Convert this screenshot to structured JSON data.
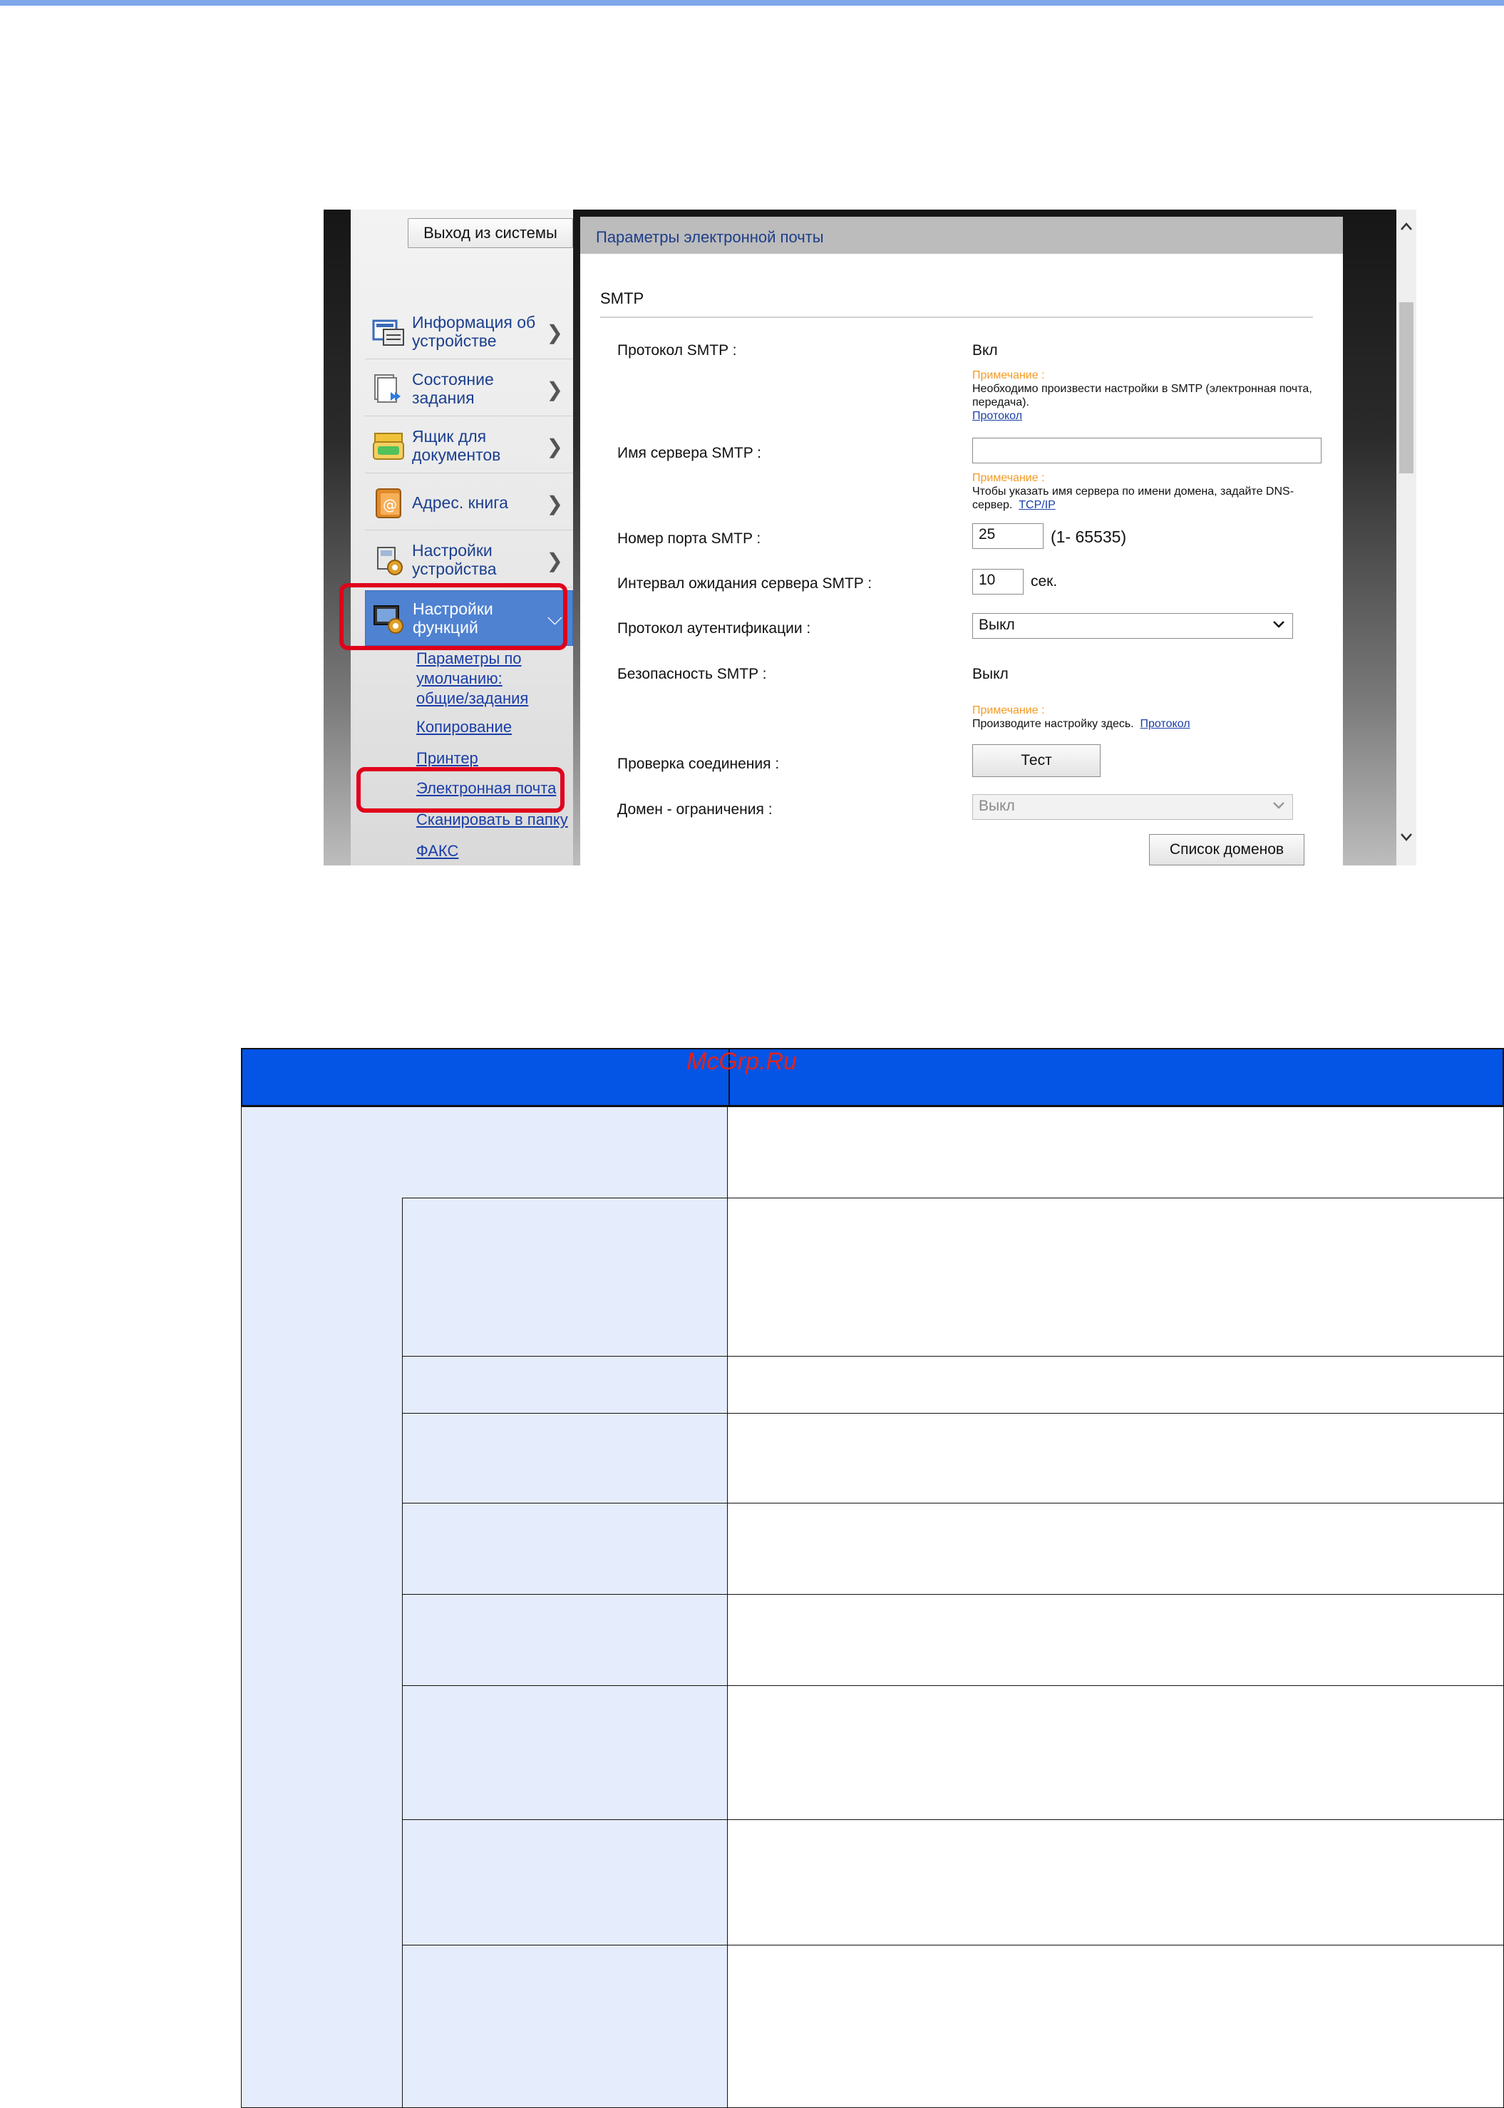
{
  "screenshot": {
    "logout_label": "Выход из системы",
    "nav_items": [
      {
        "label_line1": "Информация об",
        "label_line2": "устройстве",
        "icon": "device-info-icon"
      },
      {
        "label_line1": "Состояние",
        "label_line2": "задания",
        "icon": "job-status-icon"
      },
      {
        "label_line1": "Ящик для",
        "label_line2": "документов",
        "icon": "document-box-icon"
      },
      {
        "label_line1": "Адрес. книга",
        "label_line2": "",
        "icon": "address-book-icon"
      },
      {
        "label_line1": "Настройки",
        "label_line2": "устройства",
        "icon": "device-settings-icon"
      },
      {
        "label_line1": "Настройки",
        "label_line2": "функций",
        "icon": "function-settings-icon"
      }
    ],
    "sub_links": [
      "Параметры по умолчанию: общие/задания",
      "Копирование",
      "Принтер",
      "Электронная почта",
      "Сканировать в папку",
      "ФАКС"
    ],
    "content": {
      "header": "Параметры электронной почты",
      "section": "SMTP",
      "smtp_protocol_label": "Протокол SMTP :",
      "smtp_protocol_value": "Вкл",
      "note_label": "Примечание :",
      "note1_text": "Необходимо произвести настройки в SMTP (электронная почта, передача).",
      "note1_link": "Протокол",
      "server_name_label": "Имя сервера SMTP :",
      "server_name_value": "",
      "note2_text": "Чтобы указать имя сервера по имени домена, задайте DNS-сервер.",
      "note2_link": "TCP/IP",
      "port_label": "Номер порта SMTP :",
      "port_value": "25",
      "port_range": "(1- 65535)",
      "timeout_label": "Интервал ожидания сервера SMTP :",
      "timeout_value": "10",
      "timeout_unit": "сек.",
      "auth_label": "Протокол аутентификации :",
      "auth_value": "Выкл",
      "security_label": "Безопасность SMTP :",
      "security_value": "Выкл",
      "note3_text": "Производите настройку здесь.",
      "note3_link": "Протокол",
      "test_label": "Проверка соединения :",
      "test_button": "Тест",
      "domain_label": "Домен - ограничения :",
      "domain_value": "Выкл",
      "domain_list_button": "Список доменов"
    }
  },
  "table": {
    "header_left": "",
    "header_right": "",
    "watermark": "McGrp.Ru"
  }
}
